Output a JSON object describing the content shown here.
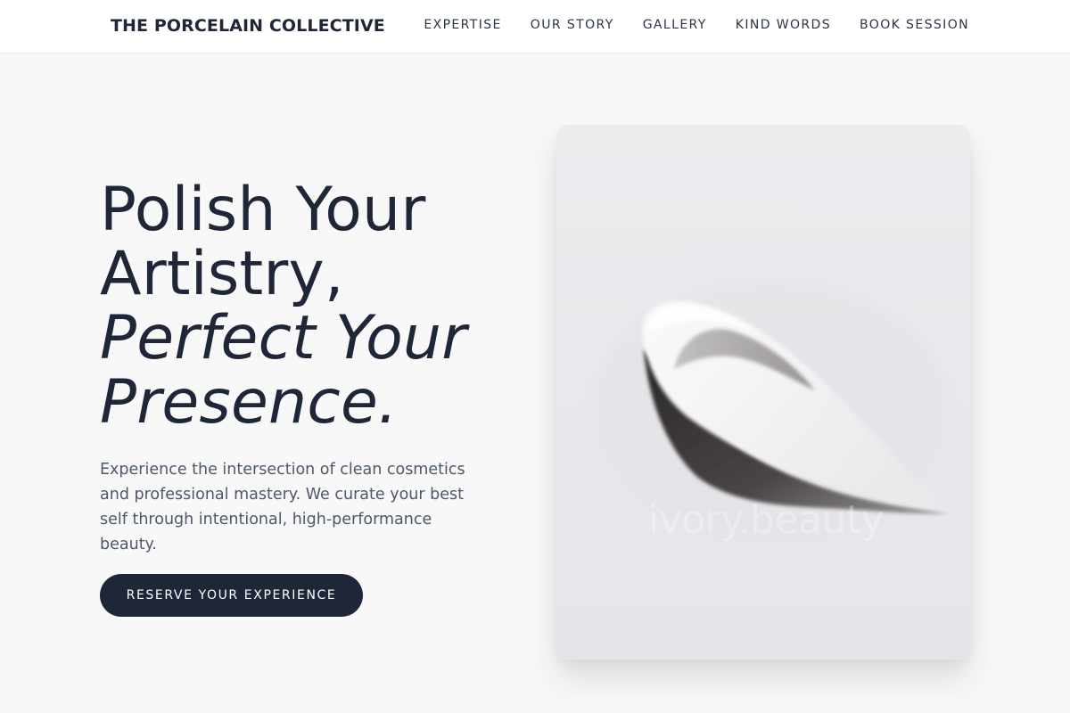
{
  "header": {
    "brand": "THE PORCELAIN COLLECTIVE",
    "nav": [
      {
        "label": "EXPERTISE"
      },
      {
        "label": "OUR STORY"
      },
      {
        "label": "GALLERY"
      },
      {
        "label": "KIND WORDS"
      },
      {
        "label": "BOOK SESSION"
      }
    ]
  },
  "hero": {
    "title_line1": "Polish Your",
    "title_line2": "Artistry,",
    "title_line3": "Perfect Your",
    "title_line4": "Presence.",
    "description": "Experience the intersection of clean cosmetics and professional mastery. We curate your best self through intentional, high-performance beauty.",
    "cta_label": "RESERVE YOUR EXPERIENCE"
  },
  "image": {
    "watermark": "ivory.beauty"
  },
  "colors": {
    "primary": "#1e2638",
    "background": "#f8f8f8",
    "body_text": "#4d5869"
  }
}
